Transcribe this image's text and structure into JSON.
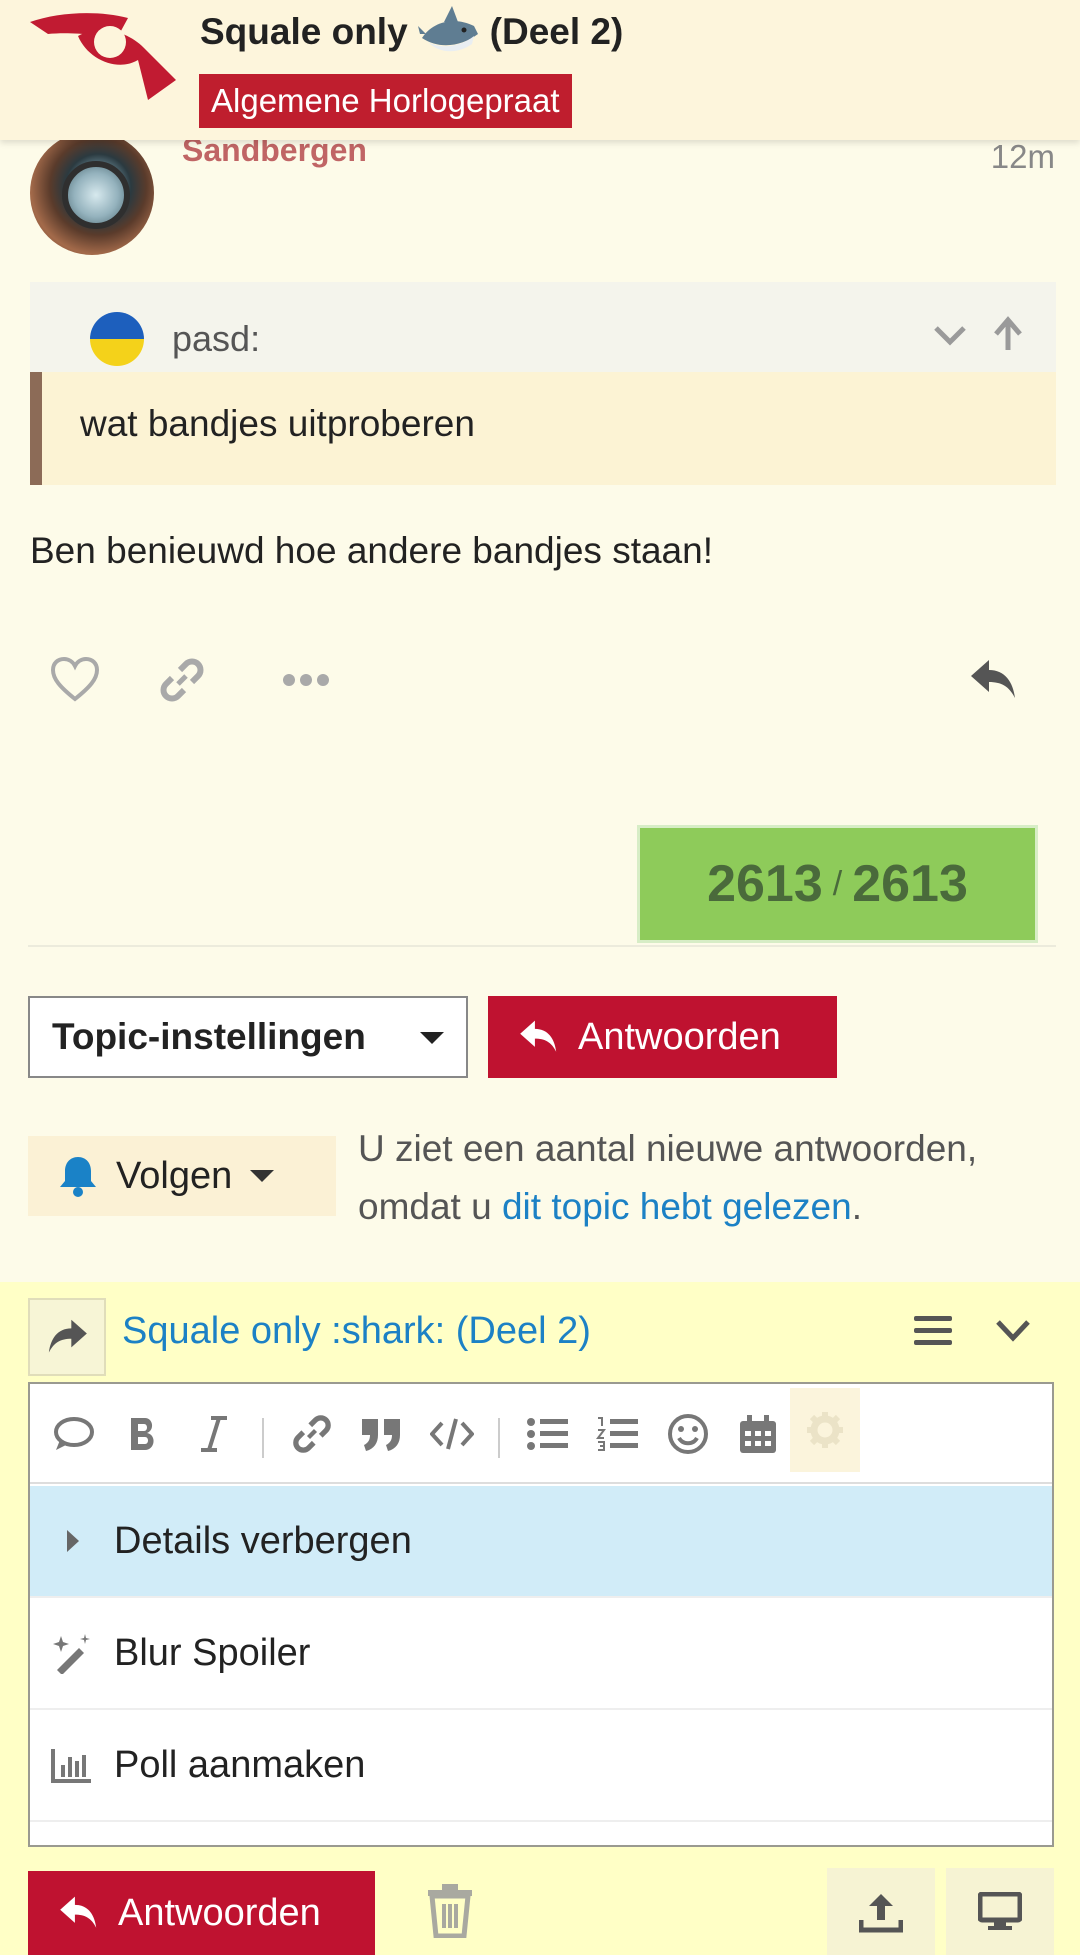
{
  "header": {
    "topic_title": "Squale only",
    "topic_suffix": "(Deel 2)",
    "category": "Algemene Horlogepraat",
    "colors": {
      "category_bg": "#bf1e2e",
      "header_bg": "#fdf5dc"
    }
  },
  "post": {
    "author": "Sandbergen",
    "time": "12m",
    "quote": {
      "user": "pasd:",
      "text": "wat bandjes uitproberen"
    },
    "text": "Ben benieuwd hoe andere bandjes staan!",
    "actions": [
      "heart-icon",
      "link-icon",
      "more-icon",
      "reply-icon"
    ]
  },
  "progress": {
    "current": "2613",
    "separator": "/",
    "total": "2613"
  },
  "controls": {
    "topic_settings": "Topic-instellingen",
    "reply": "Antwoorden",
    "notify_label": "Volgen",
    "notify_text": "U ziet een aantal nieuwe antwoorden, omdat u",
    "notify_link": "dit topic hebt gelezen",
    "notify_end": "."
  },
  "composer": {
    "title": "Squale only :shark: (Deel 2)",
    "menu": [
      {
        "label": "Details verbergen",
        "icon": "caret-right-icon"
      },
      {
        "label": "Blur Spoiler",
        "icon": "magic-wand-icon"
      },
      {
        "label": "Poll aanmaken",
        "icon": "bar-chart-icon"
      }
    ],
    "submit": "Antwoorden",
    "colors": {
      "bg": "#ffffc6",
      "submit": "#bf1230",
      "highlight": "#d1ecf8"
    }
  }
}
